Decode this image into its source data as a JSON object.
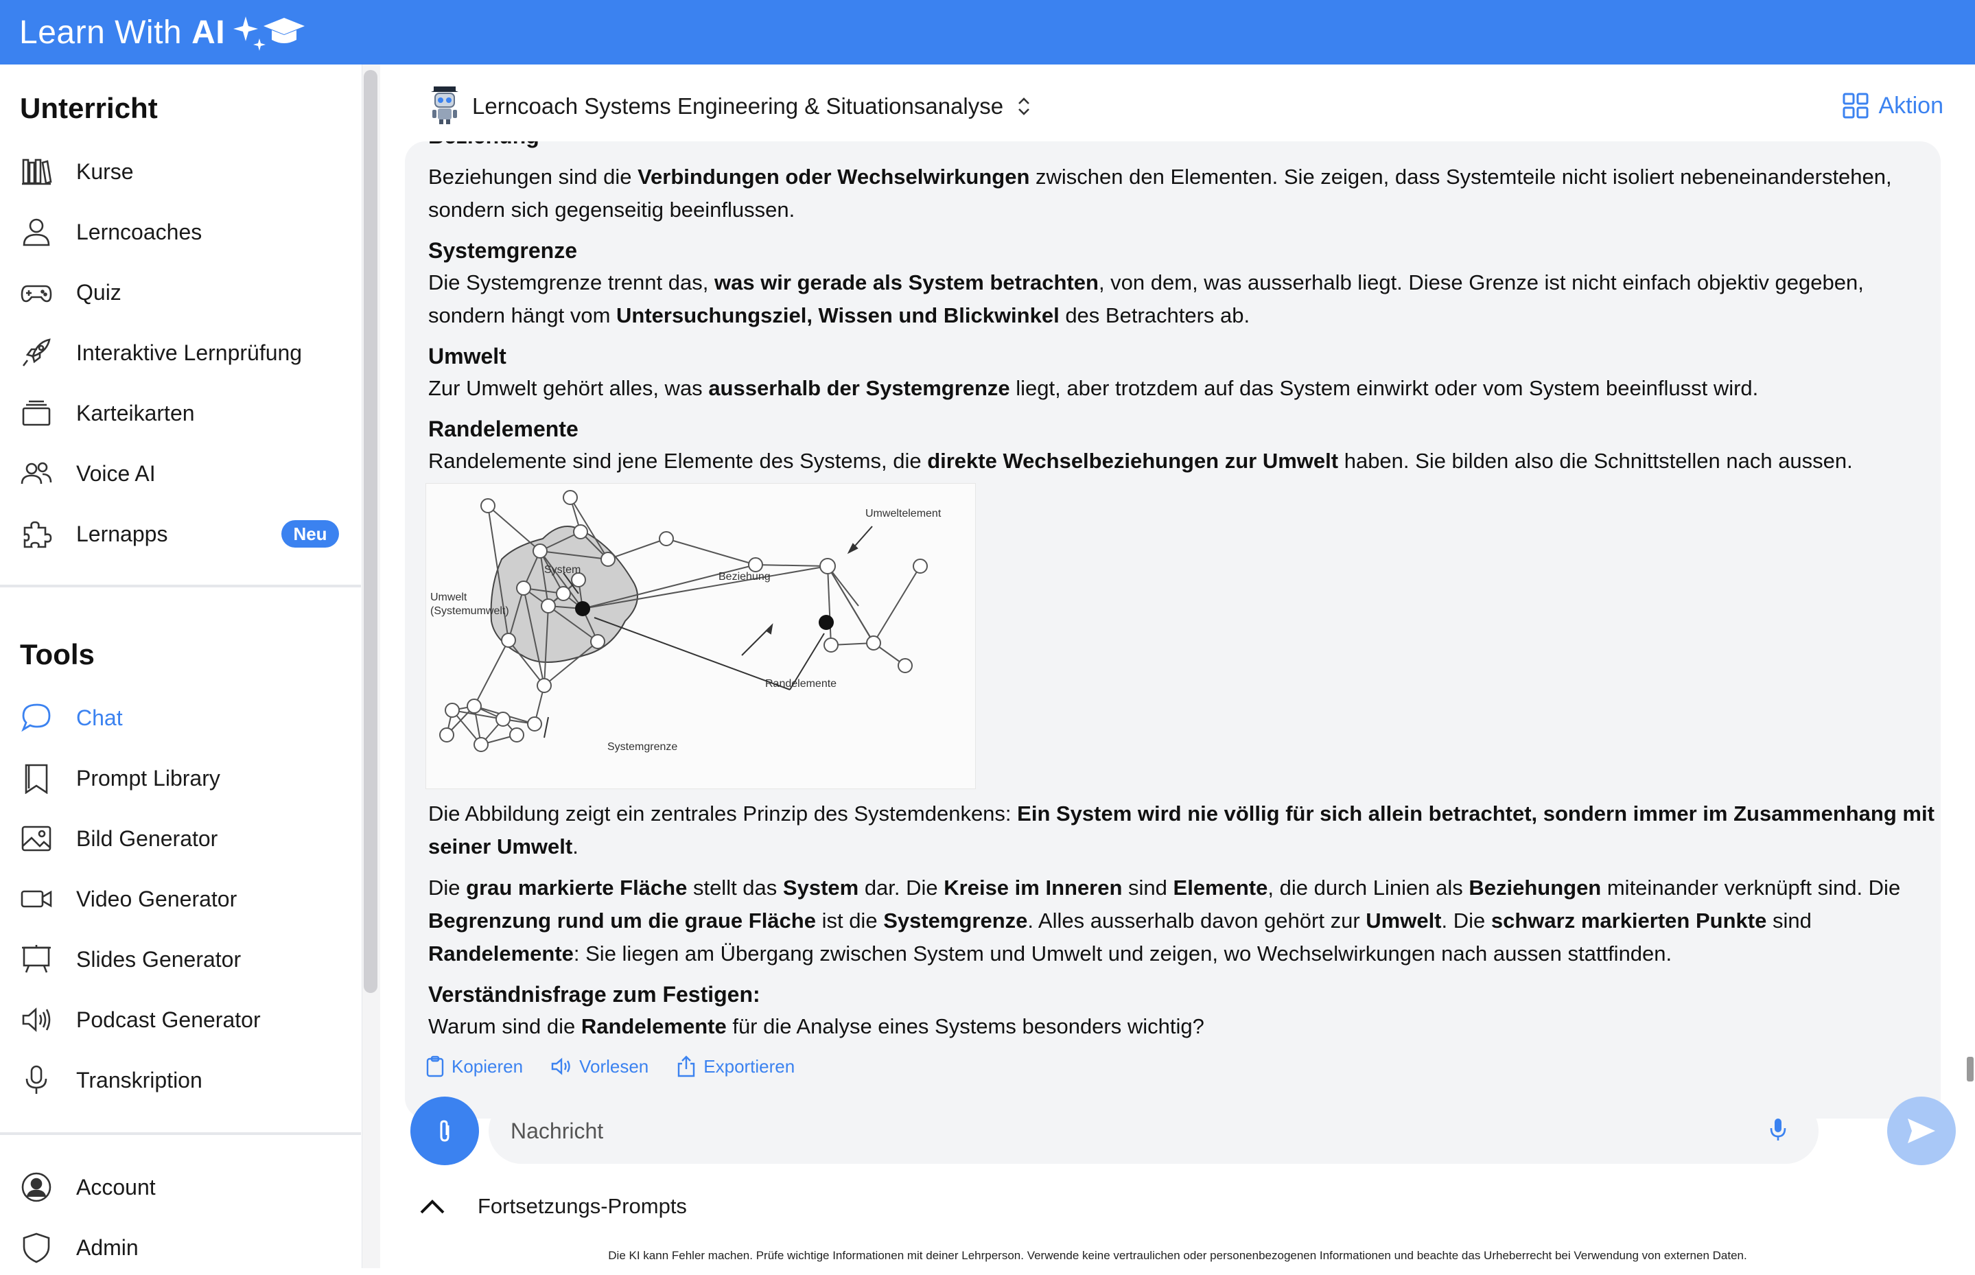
{
  "app": {
    "brand_text": "Learn With",
    "brand_ai": "AI"
  },
  "sidebar": {
    "section_unterricht": "Unterricht",
    "section_tools": "Tools",
    "unterricht_items": [
      {
        "label": "Kurse",
        "icon": "library-icon"
      },
      {
        "label": "Lerncoaches",
        "icon": "user-icon"
      },
      {
        "label": "Quiz",
        "icon": "gamepad-icon"
      },
      {
        "label": "Interaktive Lernprüfung",
        "icon": "rocket-icon"
      },
      {
        "label": "Karteikarten",
        "icon": "cards-icon"
      },
      {
        "label": "Voice AI",
        "icon": "users-icon"
      },
      {
        "label": "Lernapps",
        "icon": "puzzle-icon",
        "badge": "Neu"
      }
    ],
    "tools_items": [
      {
        "label": "Chat",
        "icon": "chat-icon",
        "active": true
      },
      {
        "label": "Prompt Library",
        "icon": "bookmark-icon"
      },
      {
        "label": "Bild Generator",
        "icon": "image-icon"
      },
      {
        "label": "Video Generator",
        "icon": "video-icon"
      },
      {
        "label": "Slides Generator",
        "icon": "presentation-icon"
      },
      {
        "label": "Podcast Generator",
        "icon": "speaker-icon"
      },
      {
        "label": "Transkription",
        "icon": "microphone-icon"
      }
    ],
    "bottom_items": [
      {
        "label": "Account",
        "icon": "account-icon"
      },
      {
        "label": "Admin",
        "icon": "shield-icon"
      }
    ]
  },
  "header": {
    "coach_title": "Lerncoach Systems Engineering & Situationsanalyse",
    "aktion": "Aktion"
  },
  "message": {
    "cut_heading": "Beziehung",
    "p1_a": "Beziehungen sind die ",
    "p1_b": "Verbindungen oder Wechselwirkungen",
    "p1_c": " zwischen den Elementen. Sie zeigen, dass Systemteile nicht isoliert nebeneinanderstehen, sondern sich gegenseitig beeinflussen.",
    "h_systemgrenze": "Systemgrenze",
    "p2_a": "Die Systemgrenze trennt das, ",
    "p2_b": "was wir gerade als System betrachten",
    "p2_c": ", von dem, was ausserhalb liegt. Diese Grenze ist nicht einfach objektiv gegeben, sondern hängt vom ",
    "p2_d": "Untersuchungsziel, Wissen und Blickwinkel",
    "p2_e": " des Betrachters ab.",
    "h_umwelt": "Umwelt",
    "p3_a": "Zur Umwelt gehört alles, was ",
    "p3_b": "ausserhalb der Systemgrenze",
    "p3_c": " liegt, aber trotzdem auf das System einwirkt oder vom System beeinflusst wird.",
    "h_randelemente": "Randelemente",
    "p4_a": "Randelemente sind jene Elemente des Systems, die ",
    "p4_b": "direkte Wechselbeziehungen zur Umwelt",
    "p4_c": " haben. Sie bilden also die Schnittstellen nach aussen.",
    "figure_labels": {
      "umweltelement": "Umweltelement",
      "system": "System",
      "beziehung": "Beziehung",
      "umwelt1": "Umwelt",
      "umwelt2": "(Systemumwelt)",
      "randelemente": "Randelemente",
      "systemgrenze": "Systemgrenze"
    },
    "p5_a": "Die Abbildung zeigt ein zentrales Prinzip des Systemdenkens: ",
    "p5_b": "Ein System wird nie völlig für sich allein betrachtet, sondern immer im Zusammenhang mit seiner Umwelt",
    "p5_c": ".",
    "p6_a": "Die ",
    "p6_b": "grau markierte Fläche",
    "p6_c": " stellt das ",
    "p6_d": "System",
    "p6_e": " dar. Die ",
    "p6_f": "Kreise im Inneren",
    "p6_g": " sind ",
    "p6_h": "Elemente",
    "p6_i": ", die durch Linien als ",
    "p6_j": "Beziehungen",
    "p6_k": " miteinander verknüpft sind. Die ",
    "p6_l": "Begrenzung rund um die graue Fläche",
    "p6_m": " ist die ",
    "p6_n": "Systemgrenze",
    "p6_o": ". Alles ausserhalb davon gehört zur ",
    "p6_p": "Umwelt",
    "p6_q": ". Die ",
    "p6_r": "schwarz markierten Punkte",
    "p6_s": " sind ",
    "p6_t": "Randelemente",
    "p6_u": ": Sie liegen am Übergang zwischen System und Umwelt und zeigen, wo Wechselwirkungen nach aussen stattfinden.",
    "h_frage": "Verständnisfrage zum Festigen:",
    "p7_a": "Warum sind die ",
    "p7_b": "Randelemente",
    "p7_c": " für die Analyse eines Systems besonders wichtig?"
  },
  "actions": {
    "copy": "Kopieren",
    "read": "Vorlesen",
    "export": "Exportieren"
  },
  "composer": {
    "placeholder": "Nachricht"
  },
  "fortsetzung": "Fortsetzungs-Prompts",
  "disclaimer": "Die KI kann Fehler machen. Prüfe wichtige Informationen mit deiner Lehrperson. Verwende keine vertraulichen oder personenbezogenen Informationen und beachte das Urheberrecht bei Verwendung von externen Daten.",
  "colors": {
    "accent": "#3b82f0",
    "bubble": "#f3f4f6",
    "send_disabled": "#a9c8f7"
  }
}
